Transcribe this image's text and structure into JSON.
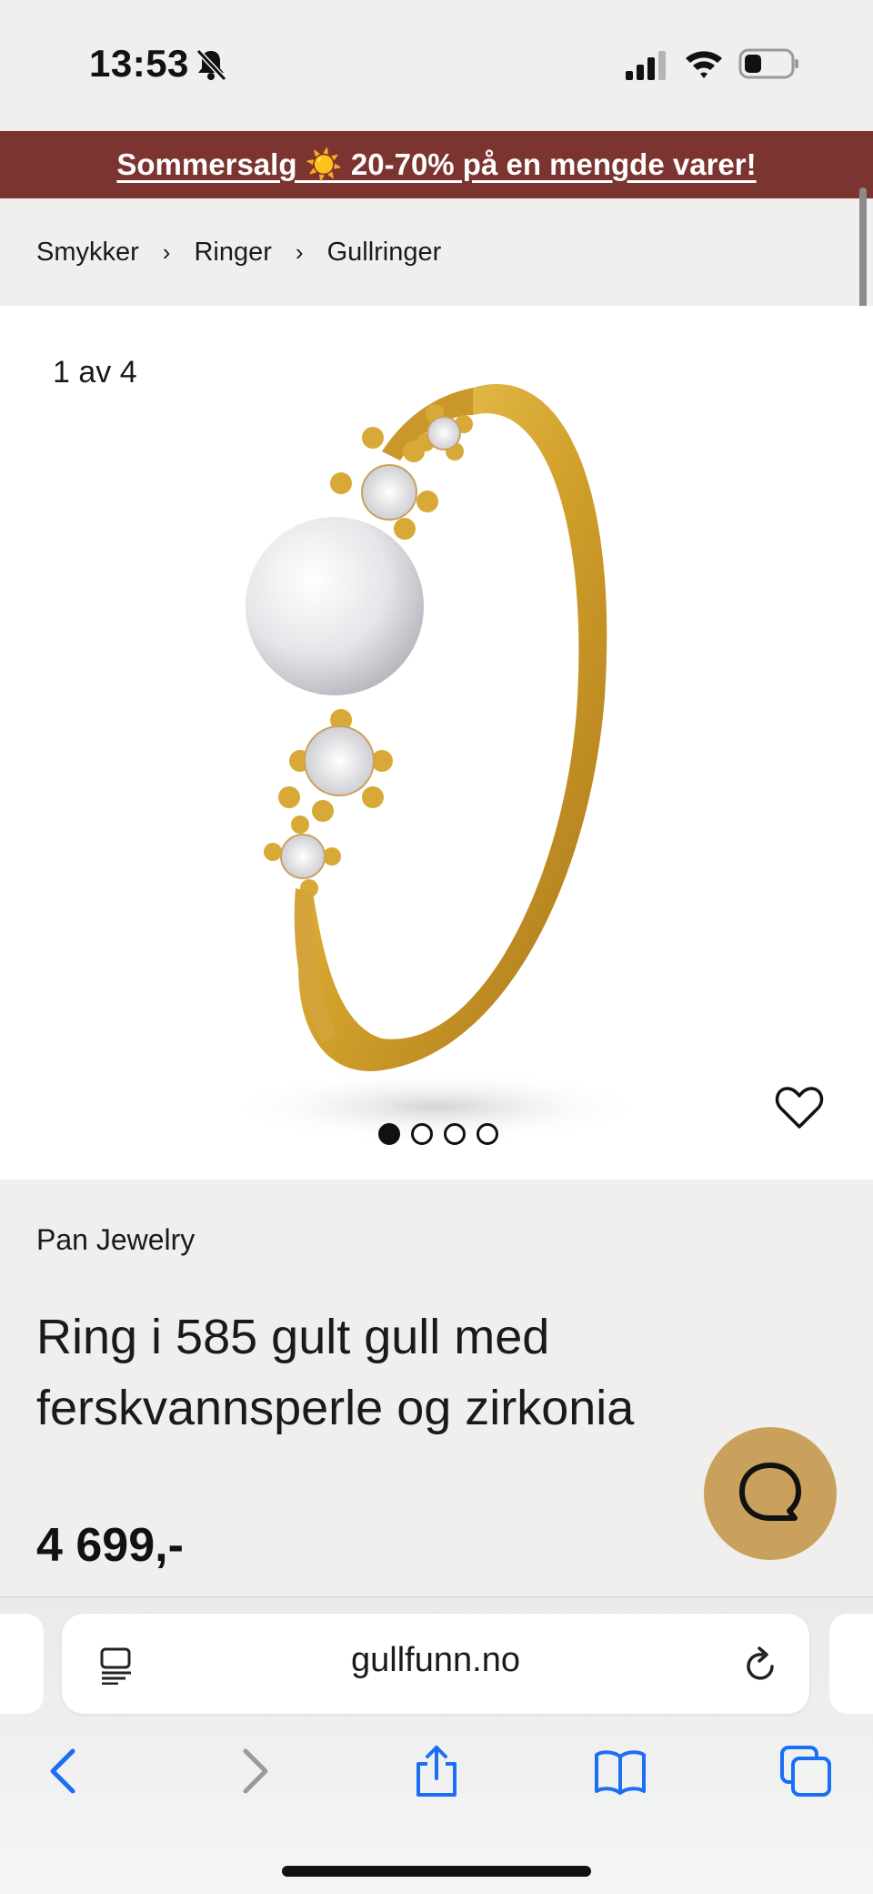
{
  "status_bar": {
    "time": "13:53",
    "icons": [
      "bell-slash-icon",
      "signal-icon",
      "wifi-icon",
      "battery-icon"
    ]
  },
  "promo": {
    "text": "Sommersalg ☀️ 20-70% på en mengde varer!",
    "background": "#7c3431"
  },
  "breadcrumb": {
    "items": [
      "Smykker",
      "Ringer",
      "Gullringer"
    ],
    "separator": "›"
  },
  "gallery": {
    "counter": "1 av 4",
    "total_images": 4,
    "active_index": 0,
    "wishlist_icon": "heart-icon"
  },
  "product": {
    "brand": "Pan Jewelry",
    "title": "Ring i 585 gult gull med ferskvannsperle og zirkonia",
    "price": "4 699,-"
  },
  "chat": {
    "icon": "chat-bubble-icon",
    "color": "#c9a15c"
  },
  "browser": {
    "url": "gullfunn.no",
    "toolbar": [
      "back-icon",
      "forward-icon",
      "share-icon",
      "bookmarks-icon",
      "tabs-icon"
    ]
  }
}
